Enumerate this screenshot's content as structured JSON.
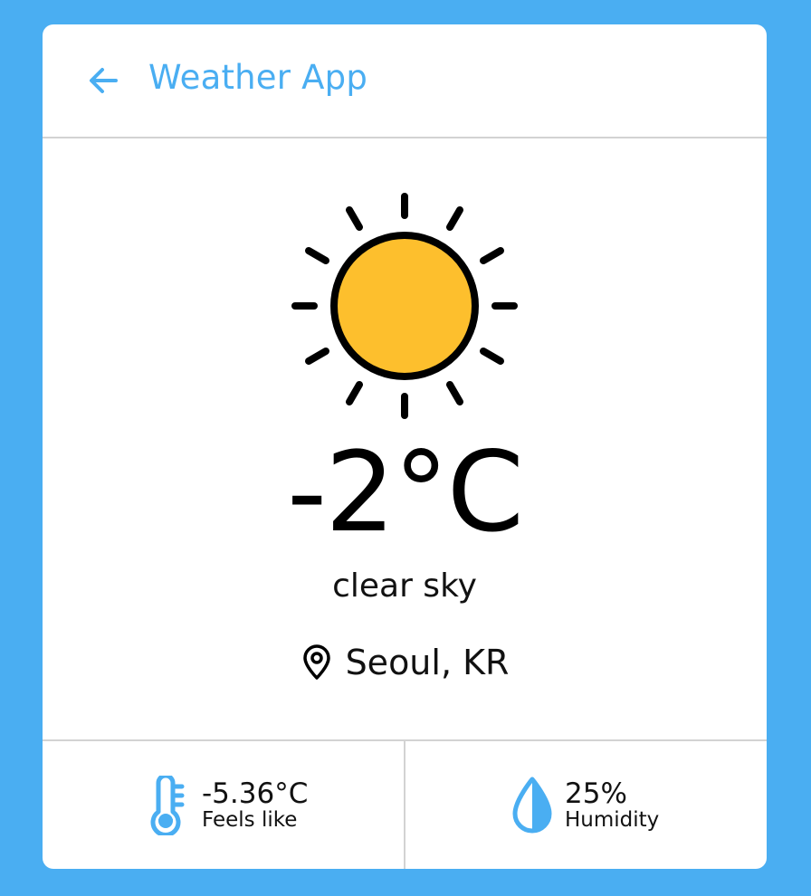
{
  "header": {
    "title": "Weather App",
    "back_icon": "arrow-left-icon"
  },
  "colors": {
    "background": "#4aaef2",
    "accent": "#4aaef2",
    "sun_fill": "#fdbf2d",
    "card": "#ffffff"
  },
  "current": {
    "condition_icon": "sun-icon",
    "temperature": "-2°C",
    "description": "clear sky",
    "location_icon": "map-pin-icon",
    "location": "Seoul, KR"
  },
  "stats": {
    "feels_like": {
      "icon": "thermometer-icon",
      "value": "-5.36°C",
      "label": "Feels like"
    },
    "humidity": {
      "icon": "water-drop-icon",
      "value": "25%",
      "label": "Humidity"
    }
  }
}
